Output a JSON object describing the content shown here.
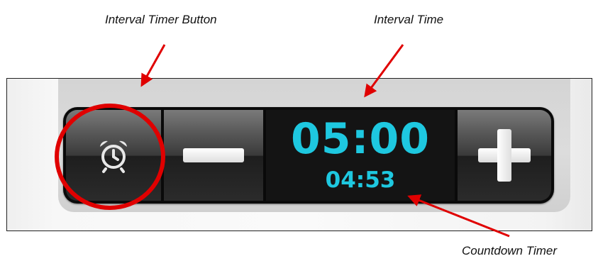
{
  "annotations": {
    "interval_timer_button": "Interval Timer Button",
    "interval_time": "Interval Time",
    "countdown_timer": "Countdown Timer"
  },
  "timer": {
    "interval_time": "05:00",
    "countdown": "04:53",
    "buttons": {
      "alarm": "alarm-clock-icon",
      "decrement": "minus-icon",
      "increment": "plus-icon"
    }
  },
  "colors": {
    "display_digits": "#1ec8e0",
    "annotation_arrow": "#e00000",
    "highlight_circle": "#e00000"
  }
}
